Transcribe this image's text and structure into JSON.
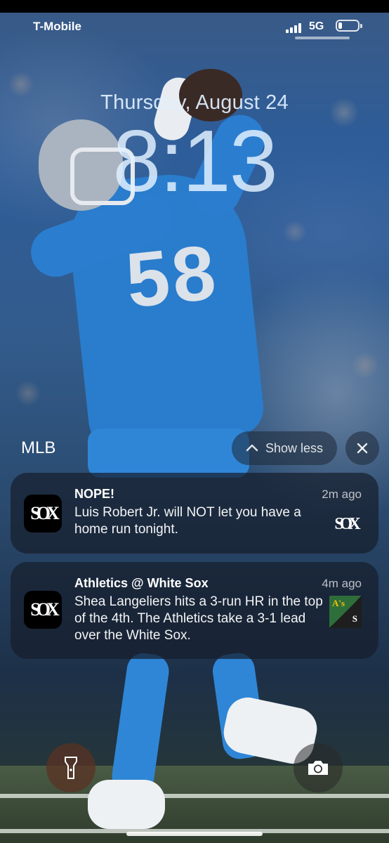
{
  "status_bar": {
    "carrier": "T-Mobile",
    "network": "5G",
    "battery_level": 0.2
  },
  "lock_screen": {
    "date": "Thursday, August 24",
    "time": "8:13"
  },
  "notification_group": {
    "app_name": "MLB",
    "show_less_label": "Show less",
    "close_icon": "xmark-icon"
  },
  "notifications": [
    {
      "title": "NOPE!",
      "time": "2m ago",
      "body": "Luis Robert Jr. will NOT let you have a home run tonight.",
      "app_icon": "white-sox-logo",
      "thumbnail": "white-sox-logo"
    },
    {
      "title": "Athletics @ White Sox",
      "time": "4m ago",
      "body": "Shea Langeliers hits a 3-run HR in the top of the 4th. The Athletics take a 3-1 lead over the White Sox.",
      "app_icon": "white-sox-logo",
      "thumbnail": "athletics-vs-white-sox-logo"
    }
  ],
  "controls": {
    "flashlight_icon": "flashlight-icon",
    "camera_icon": "camera-icon"
  },
  "logo_text": {
    "sox": "SOX",
    "athletics": "A's"
  }
}
